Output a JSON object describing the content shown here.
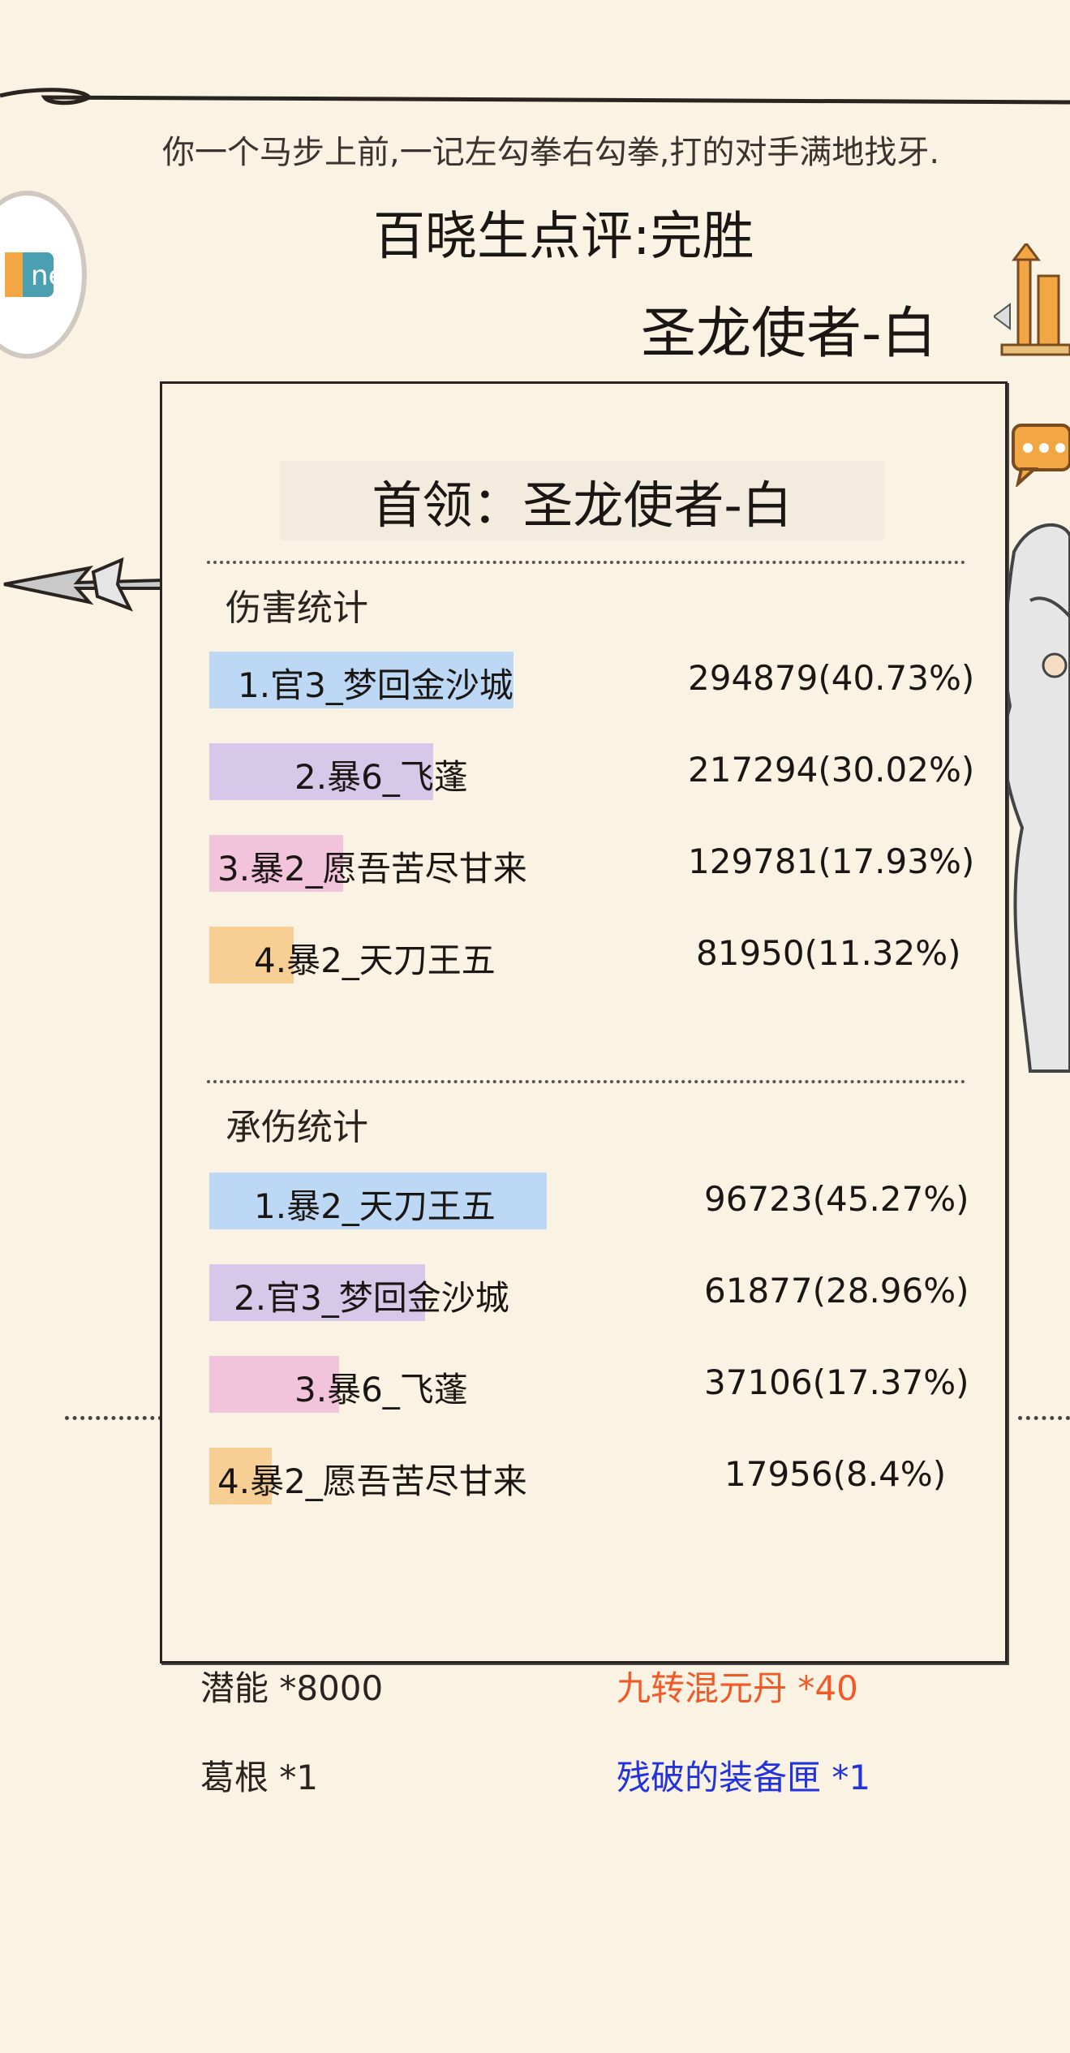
{
  "battle": {
    "narration": "你一个马步上前,一记左勾拳右勾拳,打的对手满地找牙.",
    "verdict": "百晓生点评:完胜",
    "opponent": "圣龙使者-白"
  },
  "avatar": {
    "icon": "avatar-icon",
    "tag": "ne"
  },
  "stats_panel": {
    "title": "首领：圣龙使者-白",
    "damage": {
      "title": "伤害统计",
      "rows": [
        {
          "label": "1.官3_梦回金沙城",
          "value": "294879(40.73%)",
          "percent": 40.73,
          "color": "#bcd8f5"
        },
        {
          "label": "2.暴6_飞蓬",
          "value": "217294(30.02%)",
          "percent": 30.02,
          "color": "#d5c8e8"
        },
        {
          "label": "3.暴2_愿吾苦尽甘来",
          "value": "129781(17.93%)",
          "percent": 17.93,
          "color": "#f2c4dc"
        },
        {
          "label": "4.暴2_天刀王五",
          "value": "81950(11.32%)",
          "percent": 11.32,
          "color": "#f7cf95"
        }
      ]
    },
    "taken": {
      "title": "承伤统计",
      "rows": [
        {
          "label": "1.暴2_天刀王五",
          "value": "96723(45.27%)",
          "percent": 45.27,
          "color": "#bcd8f5"
        },
        {
          "label": "2.官3_梦回金沙城",
          "value": "61877(28.96%)",
          "percent": 28.96,
          "color": "#d5c8e8"
        },
        {
          "label": "3.暴6_飞蓬",
          "value": "37106(17.37%)",
          "percent": 17.37,
          "color": "#f2c4dc"
        },
        {
          "label": "4.暴2_愿吾苦尽甘来",
          "value": "17956(8.4%)",
          "percent": 8.4,
          "color": "#f7cf95"
        }
      ]
    }
  },
  "rewards": [
    {
      "text": "潜能 *8000",
      "color": "#2a2420"
    },
    {
      "text": "九转混元丹 *40",
      "color": "#f05a28"
    },
    {
      "text": "葛根 *1",
      "color": "#2a2420"
    },
    {
      "text": "残破的装备匣 *1",
      "color": "#2233dd"
    }
  ]
}
